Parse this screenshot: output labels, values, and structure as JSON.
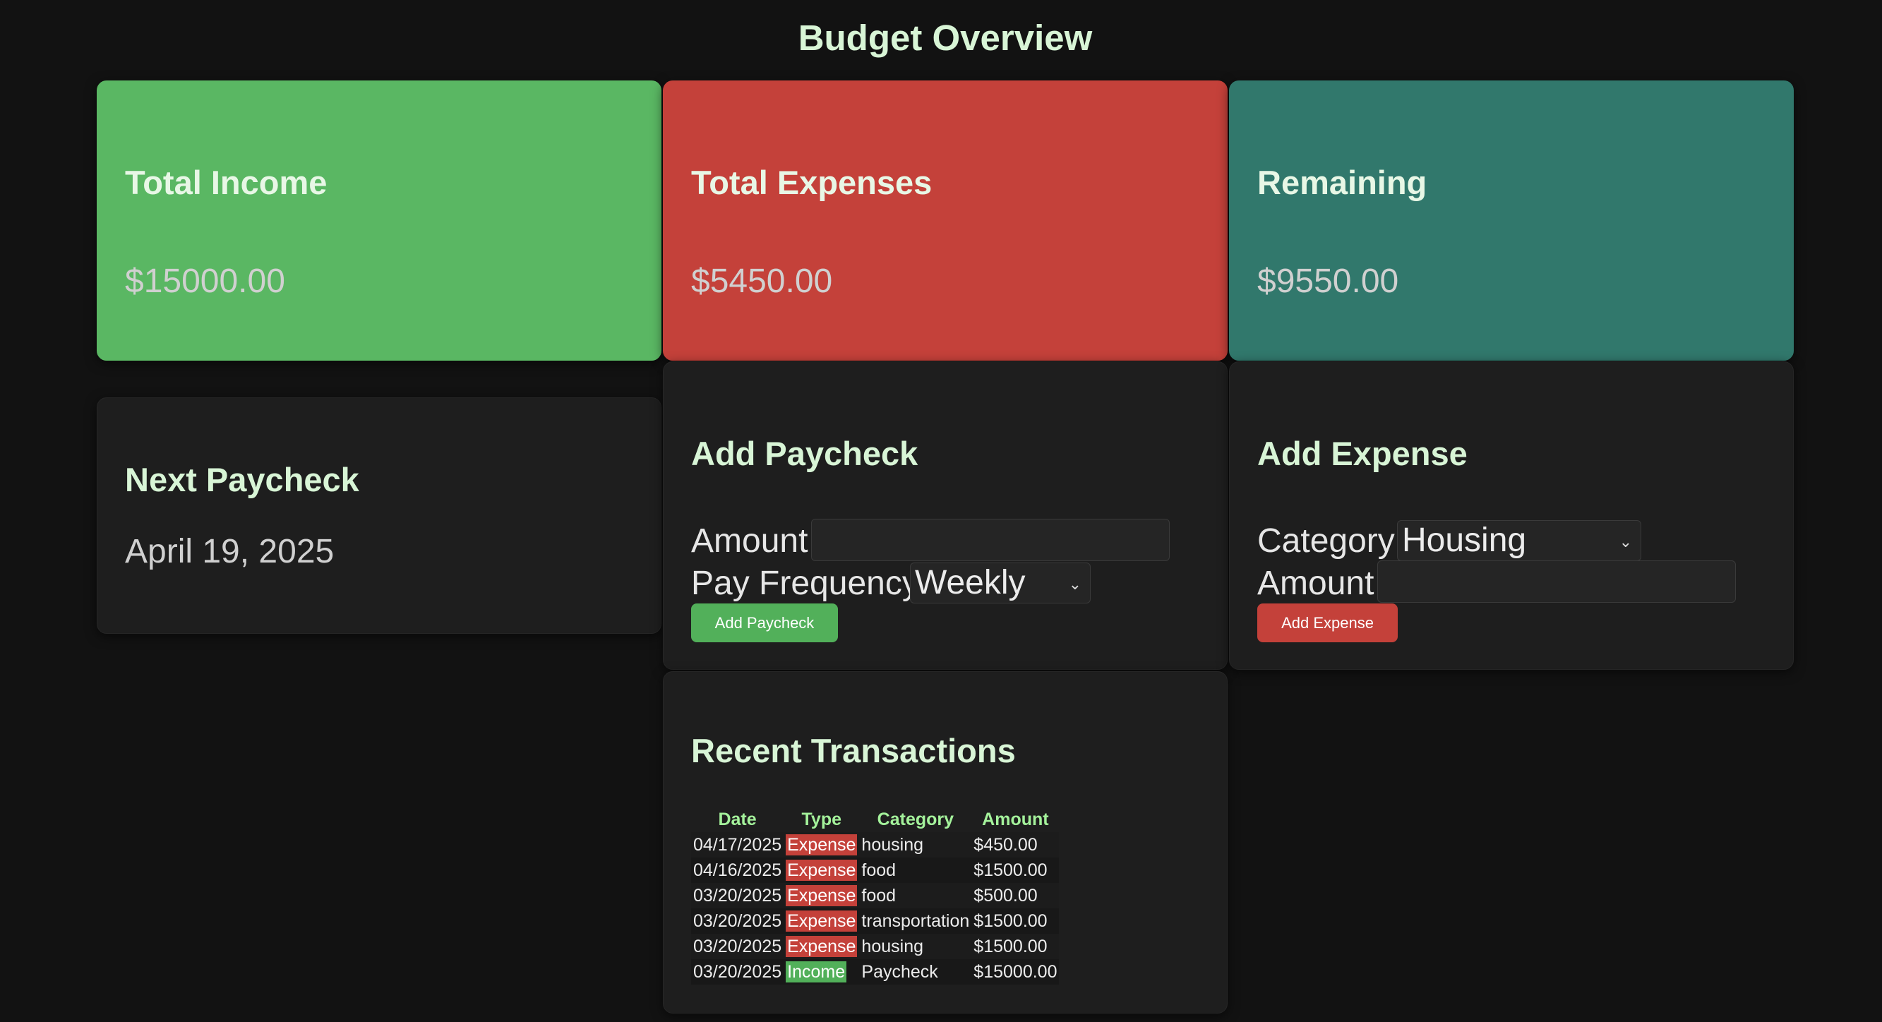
{
  "page": {
    "title": "Budget Overview"
  },
  "summary": {
    "income": {
      "label": "Total Income",
      "value": "$15000.00"
    },
    "expenses": {
      "label": "Total Expenses",
      "value": "$5450.00"
    },
    "remaining": {
      "label": "Remaining",
      "value": "$9550.00"
    }
  },
  "next_paycheck": {
    "title": "Next Paycheck",
    "date": "April 19, 2025"
  },
  "add_paycheck": {
    "title": "Add Paycheck",
    "amount_label": "Amount",
    "amount_value": "",
    "frequency_label": "Pay Frequency",
    "frequency_value": "Weekly",
    "button_label": "Add Paycheck"
  },
  "add_expense": {
    "title": "Add Expense",
    "category_label": "Category",
    "category_value": "Housing",
    "amount_label": "Amount",
    "amount_value": "",
    "button_label": "Add Expense"
  },
  "transactions": {
    "title": "Recent Transactions",
    "headers": [
      "Date",
      "Type",
      "Category",
      "Amount"
    ],
    "rows": [
      {
        "date": "04/17/2025",
        "type": "Expense",
        "category": "housing",
        "amount": "$450.00"
      },
      {
        "date": "04/16/2025",
        "type": "Expense",
        "category": "food",
        "amount": "$1500.00"
      },
      {
        "date": "03/20/2025",
        "type": "Expense",
        "category": "food",
        "amount": "$500.00"
      },
      {
        "date": "03/20/2025",
        "type": "Expense",
        "category": "transportation",
        "amount": "$1500.00"
      },
      {
        "date": "03/20/2025",
        "type": "Expense",
        "category": "housing",
        "amount": "$1500.00"
      },
      {
        "date": "03/20/2025",
        "type": "Income",
        "category": "Paycheck",
        "amount": "$15000.00"
      }
    ]
  },
  "colors": {
    "income": "#5ab763",
    "expense": "#c4413a",
    "remaining": "#31786c",
    "heading": "#d8f5d6",
    "table_header": "#a4f29b"
  },
  "icons": {
    "select_chevron": "chevron-down-icon"
  }
}
